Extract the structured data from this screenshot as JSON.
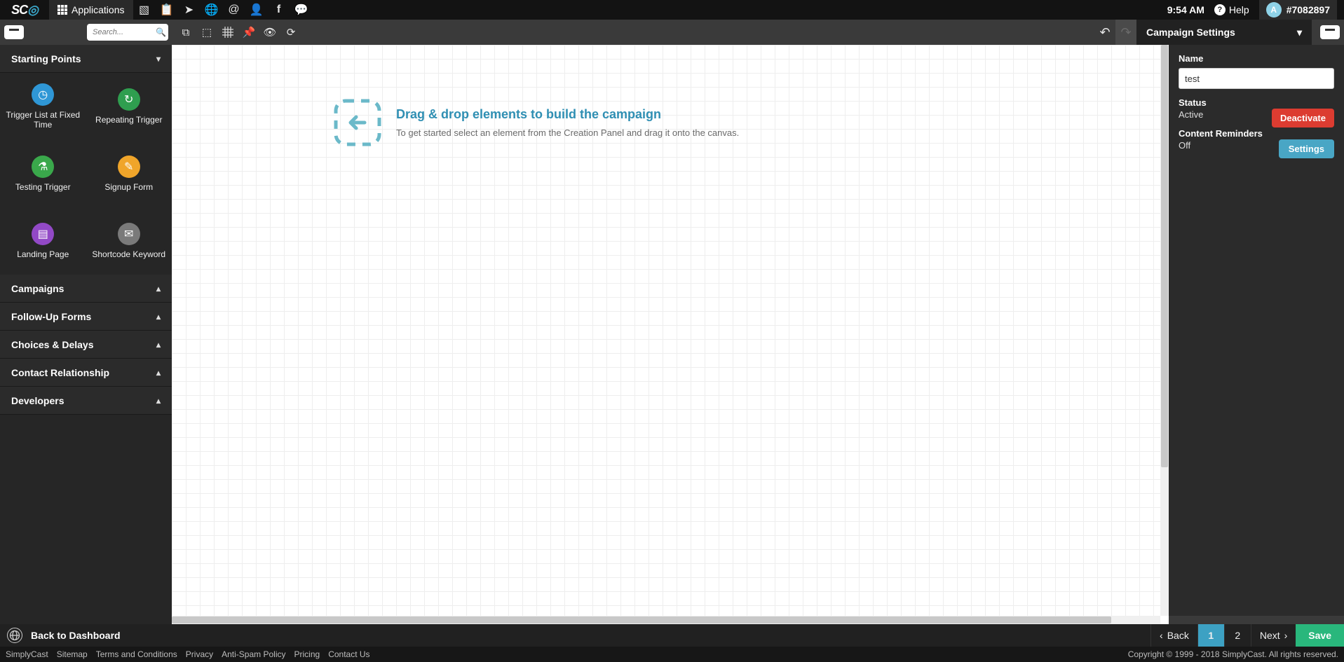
{
  "topbar": {
    "logo_sc": "SC",
    "applications": "Applications",
    "time": "9:54 AM",
    "help": "Help",
    "avatar_letter": "A",
    "account_id": "#7082897"
  },
  "search": {
    "placeholder": "Search..."
  },
  "palette": {
    "header": "Starting Points",
    "items": [
      {
        "label": "Trigger List at Fixed Time",
        "icon_name": "clock-icon",
        "glyph": "◷",
        "bg": "#2f97d6"
      },
      {
        "label": "Repeating Trigger",
        "icon_name": "repeat-icon",
        "glyph": "↻",
        "bg": "#2f9e4f"
      },
      {
        "label": "Testing Trigger",
        "icon_name": "flask-icon",
        "glyph": "⚗",
        "bg": "#3aa84b"
      },
      {
        "label": "Signup Form",
        "icon_name": "signup-icon",
        "glyph": "✎",
        "bg": "#f0a52a"
      },
      {
        "label": "Landing Page",
        "icon_name": "landing-icon",
        "glyph": "▤",
        "bg": "#9249c6"
      },
      {
        "label": "Shortcode Keyword",
        "icon_name": "shortcode-icon",
        "glyph": "✉",
        "bg": "#7a7a7a"
      }
    ],
    "sections": [
      "Campaigns",
      "Follow-Up Forms",
      "Choices & Delays",
      "Contact Relationship",
      "Developers"
    ]
  },
  "canvas": {
    "headline": "Drag & drop elements to build the campaign",
    "sub": "To get started select an element from the Creation Panel and drag it onto the canvas."
  },
  "settings": {
    "title": "Campaign Settings",
    "name_label": "Name",
    "name_value": "test",
    "status_label": "Status",
    "status_value": "Active",
    "deactivate_btn": "Deactivate",
    "reminders_label": "Content Reminders",
    "reminders_value": "Off",
    "settings_btn": "Settings"
  },
  "bottom": {
    "back": "Back to Dashboard",
    "back_btn": "Back",
    "page1": "1",
    "page2": "2",
    "next_btn": "Next",
    "save_btn": "Save"
  },
  "footer": {
    "links": [
      "SimplyCast",
      "Sitemap",
      "Terms and Conditions",
      "Privacy",
      "Anti-Spam Policy",
      "Pricing",
      "Contact Us"
    ],
    "copyright": "Copyright © 1999 - 2018 SimplyCast. All rights reserved."
  }
}
